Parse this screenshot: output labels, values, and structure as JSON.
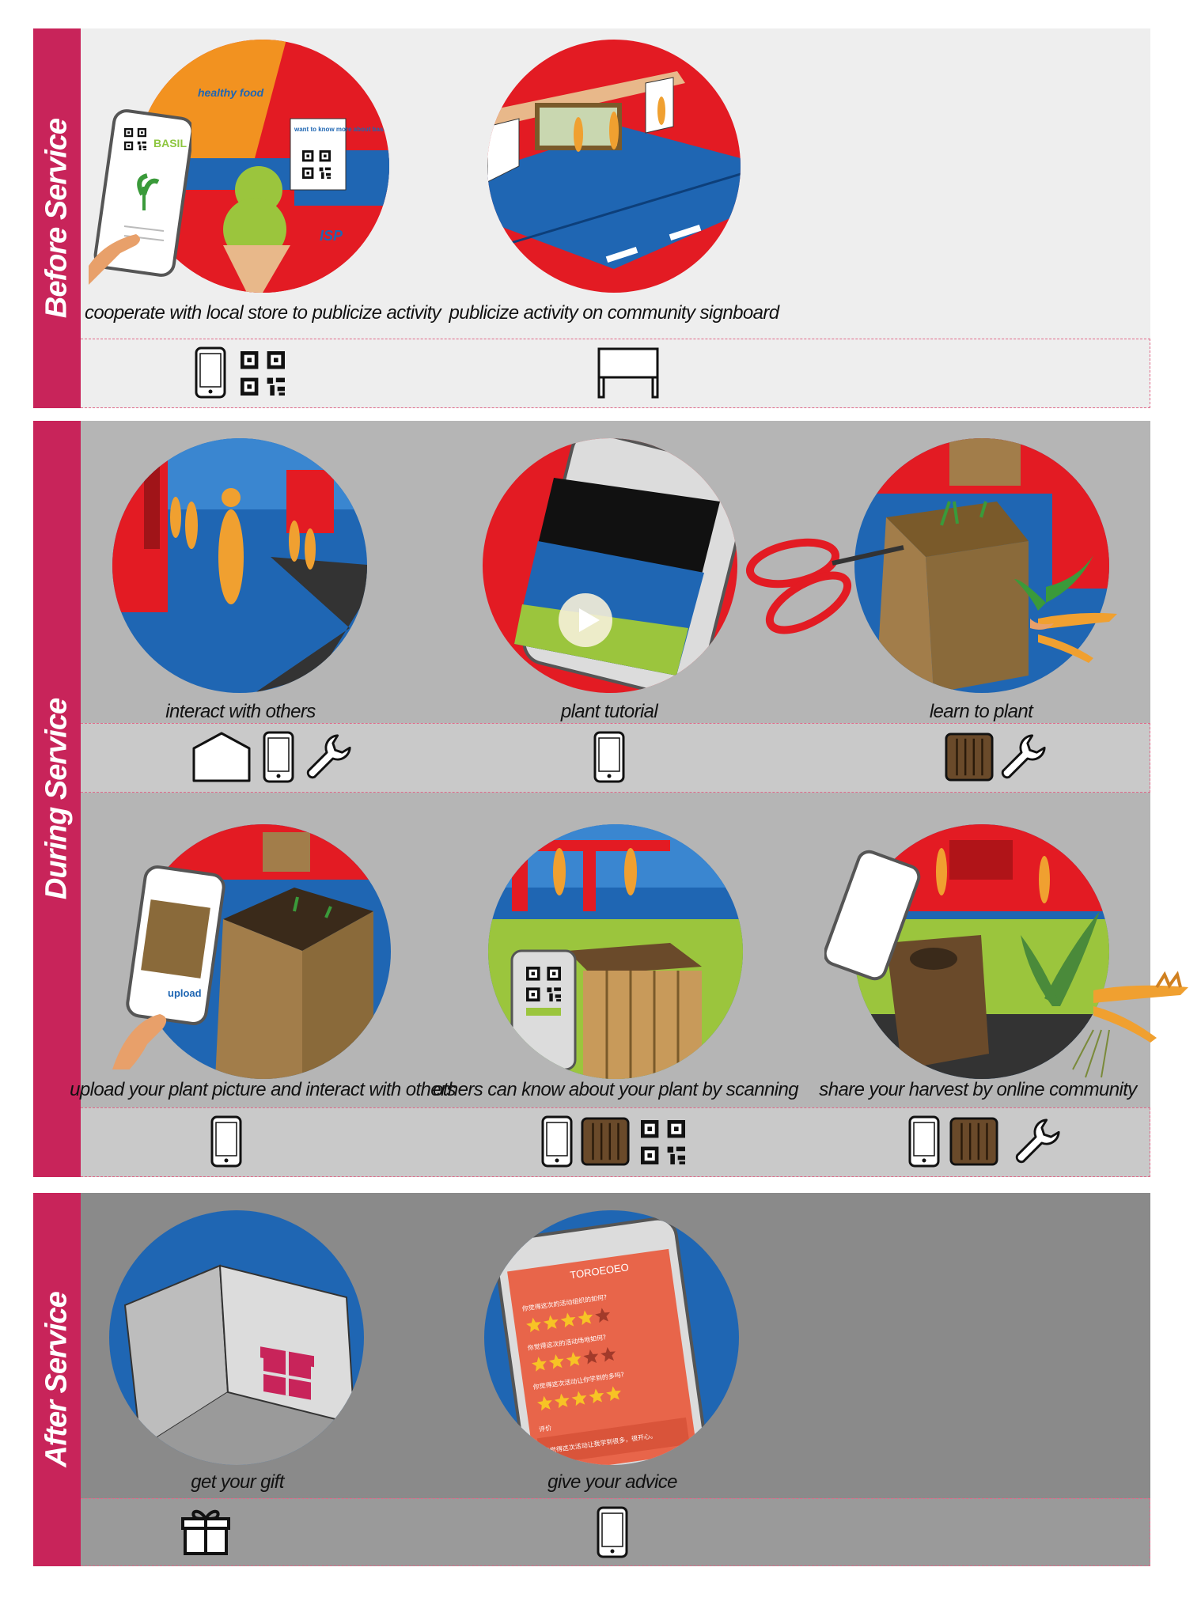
{
  "stages": {
    "before": {
      "label": "Before Service",
      "steps": [
        {
          "caption": "cooperate with local store to publicize activity",
          "scene_text": {
            "banner": "healthy food",
            "poster": "want to know more about basil?",
            "phone_label": "BASIL",
            "store_sign": "ISP"
          },
          "touchpoints": [
            "phone-icon",
            "qr-code-icon"
          ]
        },
        {
          "caption": "publicize activity on community signboard",
          "touchpoints": [
            "signboard-icon"
          ]
        }
      ]
    },
    "during": {
      "label": "During Service",
      "steps": [
        {
          "caption": "interact with others",
          "touchpoints": [
            "house-icon",
            "phone-icon",
            "wrench-icon"
          ]
        },
        {
          "caption": "plant tutorial",
          "touchpoints": [
            "phone-icon"
          ]
        },
        {
          "caption": "learn to plant",
          "touchpoints": [
            "planter-box-icon",
            "wrench-icon"
          ]
        },
        {
          "caption": "upload your plant picture and interact with others",
          "scene_text": {
            "phone_button": "upload"
          },
          "touchpoints": [
            "phone-icon"
          ]
        },
        {
          "caption": "others can know about your plant by scanning",
          "touchpoints": [
            "phone-icon",
            "planter-box-icon",
            "qr-code-icon"
          ]
        },
        {
          "caption": "share your harvest by online community",
          "touchpoints": [
            "phone-icon",
            "planter-box-icon",
            "wrench-icon"
          ]
        }
      ]
    },
    "after": {
      "label": "After Service",
      "steps": [
        {
          "caption": "get your gift",
          "touchpoints": [
            "gift-icon"
          ]
        },
        {
          "caption": "give your advice",
          "scene_text": {
            "app_title": "TOROEOEO",
            "q1": "你觉得这次的活动组织的如何?",
            "q2": "你觉得这次的活动场地如何?",
            "q3": "你觉得这次活动让你学到的多吗?",
            "comment_label": "评价",
            "comment": "我觉得这次活动让我学到很多，很开心。"
          },
          "touchpoints": [
            "phone-icon"
          ]
        }
      ]
    }
  },
  "ratings": [
    4,
    3,
    5
  ],
  "colors": {
    "stage_bar": "#c8245a",
    "before_bg": "#eeeeee",
    "during_bg": "#b5b5b5",
    "during_band": "#c9c9c9",
    "after_bg": "#8a8a8a",
    "after_band": "#9a9a9a",
    "scene_red": "#e31b23",
    "scene_blue": "#1f66b3",
    "figure_orange": "#f0a030",
    "cardboard": "#a27d4a",
    "grass": "#9bc53d"
  }
}
